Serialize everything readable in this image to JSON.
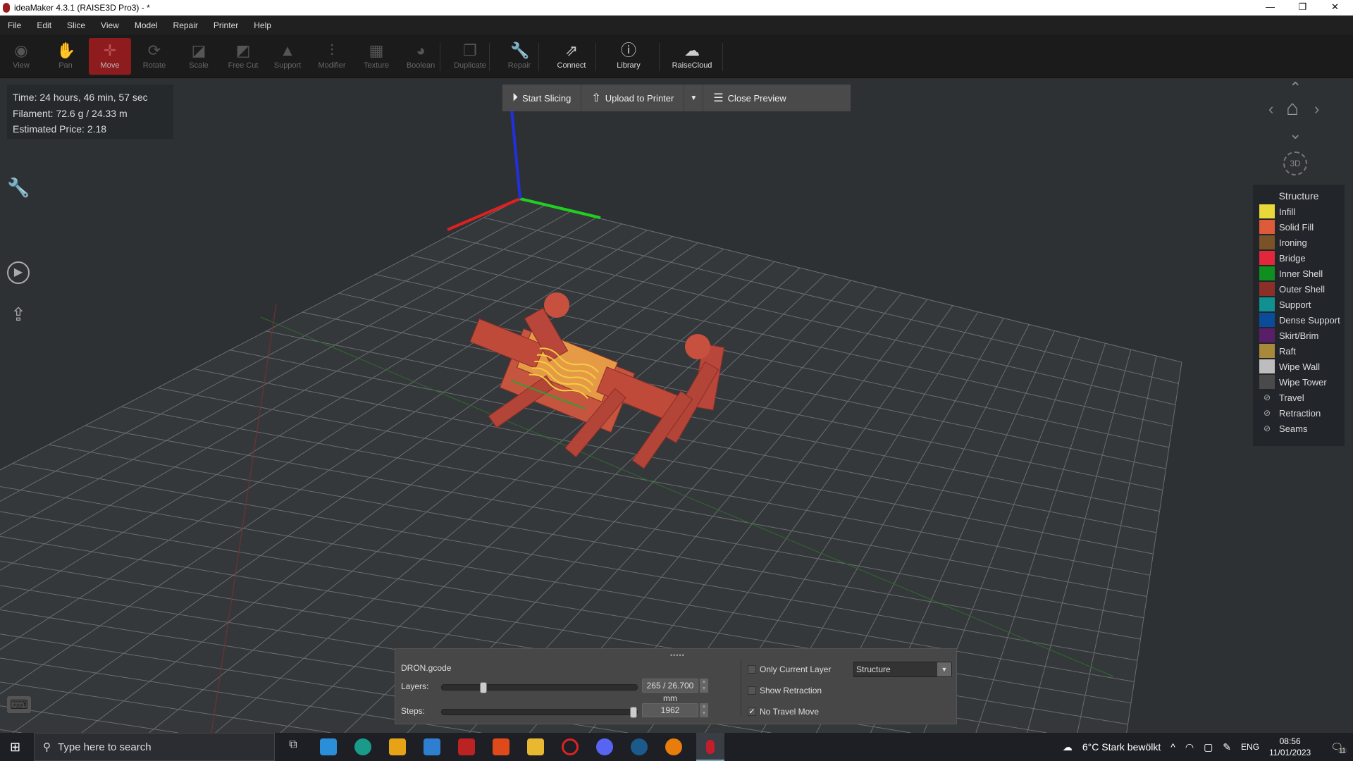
{
  "window": {
    "title": "ideaMaker 4.3.1 (RAISE3D Pro3) - *",
    "minimize": "—",
    "maximize": "❐",
    "close": "✕"
  },
  "menu": [
    "File",
    "Edit",
    "Slice",
    "View",
    "Model",
    "Repair",
    "Printer",
    "Help"
  ],
  "toolbar": [
    {
      "label": "View",
      "icon": "eye-icon",
      "glyph": "◉",
      "state": "disabled"
    },
    {
      "label": "Pan",
      "icon": "hand-icon",
      "glyph": "✋",
      "state": "disabled"
    },
    {
      "label": "Move",
      "icon": "move-icon",
      "glyph": "✛",
      "state": "active"
    },
    {
      "label": "Rotate",
      "icon": "rotate-icon",
      "glyph": "⟳",
      "state": "disabled"
    },
    {
      "label": "Scale",
      "icon": "scale-icon",
      "glyph": "◪",
      "state": "disabled"
    },
    {
      "label": "Free Cut",
      "icon": "cut-icon",
      "glyph": "◩",
      "state": "disabled"
    },
    {
      "label": "Support",
      "icon": "support-icon",
      "glyph": "▲",
      "state": "disabled"
    },
    {
      "label": "Modifier",
      "icon": "modifier-icon",
      "glyph": "⫶",
      "state": "disabled"
    },
    {
      "label": "Texture",
      "icon": "texture-icon",
      "glyph": "▦",
      "state": "disabled"
    },
    {
      "label": "Boolean",
      "icon": "boolean-icon",
      "glyph": "◕",
      "state": "disabled"
    },
    {
      "label": "Duplicate",
      "icon": "duplicate-icon",
      "glyph": "❐",
      "state": "disabled"
    },
    {
      "label": "Repair",
      "icon": "wrench-icon",
      "glyph": "🔧",
      "state": "disabled"
    },
    {
      "label": "Connect",
      "icon": "connect-icon",
      "glyph": "⇗",
      "state": "enabled"
    },
    {
      "label": "Library",
      "icon": "library-icon",
      "glyph": "ⓘ",
      "state": "enabled"
    },
    {
      "label": "RaiseCloud",
      "icon": "cloud-icon",
      "glyph": "☁",
      "state": "enabled"
    }
  ],
  "info": {
    "time": "Time: 24 hours, 46 min, 57 sec",
    "filament": "Filament: 72.6 g / 24.33 m",
    "price": "Estimated Price: 2.18"
  },
  "actions": {
    "start": "Start Slicing",
    "upload": "Upload to Printer",
    "close": "Close Preview"
  },
  "nav": {
    "view3d": "3D"
  },
  "legend": {
    "title": "Structure",
    "items": [
      {
        "label": "Infill",
        "color": "#e8d83a"
      },
      {
        "label": "Solid Fill",
        "color": "#dd5a3a"
      },
      {
        "label": "Ironing",
        "color": "#7a5228"
      },
      {
        "label": "Bridge",
        "color": "#e0283a"
      },
      {
        "label": "Inner Shell",
        "color": "#0f8f1f"
      },
      {
        "label": "Outer Shell",
        "color": "#8a3028"
      },
      {
        "label": "Support",
        "color": "#109090"
      },
      {
        "label": "Dense Support",
        "color": "#0a4c9a"
      },
      {
        "label": "Skirt/Brim",
        "color": "#581f68"
      },
      {
        "label": "Raft",
        "color": "#a8883a"
      },
      {
        "label": "Wipe Wall",
        "color": "#bdbdbd"
      },
      {
        "label": "Wipe Tower",
        "color": "#4a4a4a"
      }
    ],
    "hidden": [
      "Travel",
      "Retraction",
      "Seams"
    ]
  },
  "bottom": {
    "file": "DRON.gcode",
    "layers_label": "Layers:",
    "layers_value": "265 / 26.700 mm",
    "layers_fraction": 0.2,
    "steps_label": "Steps:",
    "steps_value": "1962",
    "steps_fraction": 1.0,
    "only_current_layer": {
      "label": "Only Current Layer",
      "checked": false
    },
    "show_retraction": {
      "label": "Show Retraction",
      "checked": false
    },
    "no_travel_move": {
      "label": "No Travel Move",
      "checked": true
    },
    "view_mode": "Structure"
  },
  "taskbar": {
    "search_placeholder": "Type here to search",
    "weather": "6°C  Stark bewölkt",
    "lang": "ENG",
    "time": "08:56",
    "date": "11/01/2023",
    "notifications": "11"
  }
}
